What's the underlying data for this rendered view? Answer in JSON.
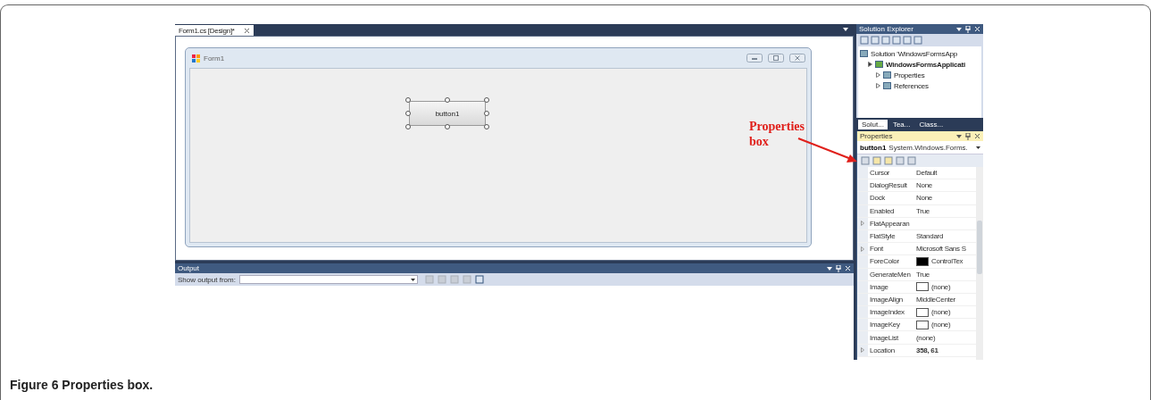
{
  "document_tab": {
    "label": "Form1.cs [Design]*",
    "selected": true
  },
  "form": {
    "title": "Form1",
    "button": "button1"
  },
  "output": {
    "title": "Output",
    "show_from_label": "Show output from:"
  },
  "solution_explorer": {
    "title": "Solution Explorer",
    "tree": [
      {
        "label": "Solution 'WindowsFormsApp",
        "children": [
          {
            "label": "WindowsFormsApplicati",
            "bold": true,
            "children": [
              {
                "label": "Properties"
              },
              {
                "label": "References"
              }
            ]
          }
        ]
      }
    ],
    "tabs": [
      {
        "label": "Solut...",
        "selected": true
      },
      {
        "label": "Tea...",
        "selected": false
      },
      {
        "label": "Class...",
        "selected": false
      }
    ]
  },
  "properties": {
    "title": "Properties",
    "object_name": "button1",
    "object_type": "System.Windows.Forms.",
    "rows": [
      {
        "name": "Cursor",
        "value": "Default",
        "expandable": false
      },
      {
        "name": "DialogResult",
        "value": "None",
        "expandable": false
      },
      {
        "name": "Dock",
        "value": "None",
        "expandable": false
      },
      {
        "name": "Enabled",
        "value": "True",
        "expandable": false
      },
      {
        "name": "FlatAppearan",
        "expandable": true
      },
      {
        "name": "FlatStyle",
        "value": "Standard",
        "expandable": false
      },
      {
        "name": "Font",
        "value": "Microsoft Sans S",
        "expandable": true
      },
      {
        "name": "ForeColor",
        "value": "ControlTex",
        "expandable": false,
        "color": "#000000"
      },
      {
        "name": "GenerateMen",
        "value": "True",
        "expandable": false
      },
      {
        "name": "Image",
        "value": "(none)",
        "expandable": false,
        "color": "#ffffff"
      },
      {
        "name": "ImageAlign",
        "value": "MiddleCenter",
        "expandable": false
      },
      {
        "name": "ImageIndex",
        "value": "(none)",
        "expandable": false,
        "color": "#ffffff"
      },
      {
        "name": "ImageKey",
        "value": "(none)",
        "expandable": false,
        "color": "#ffffff"
      },
      {
        "name": "ImageList",
        "value": "(none)",
        "expandable": false
      },
      {
        "name": "Location",
        "value": "358, 61",
        "expandable": true,
        "bold": true
      }
    ]
  },
  "annotation": {
    "text": "Properties box"
  },
  "caption": "Figure 6 Properties box."
}
